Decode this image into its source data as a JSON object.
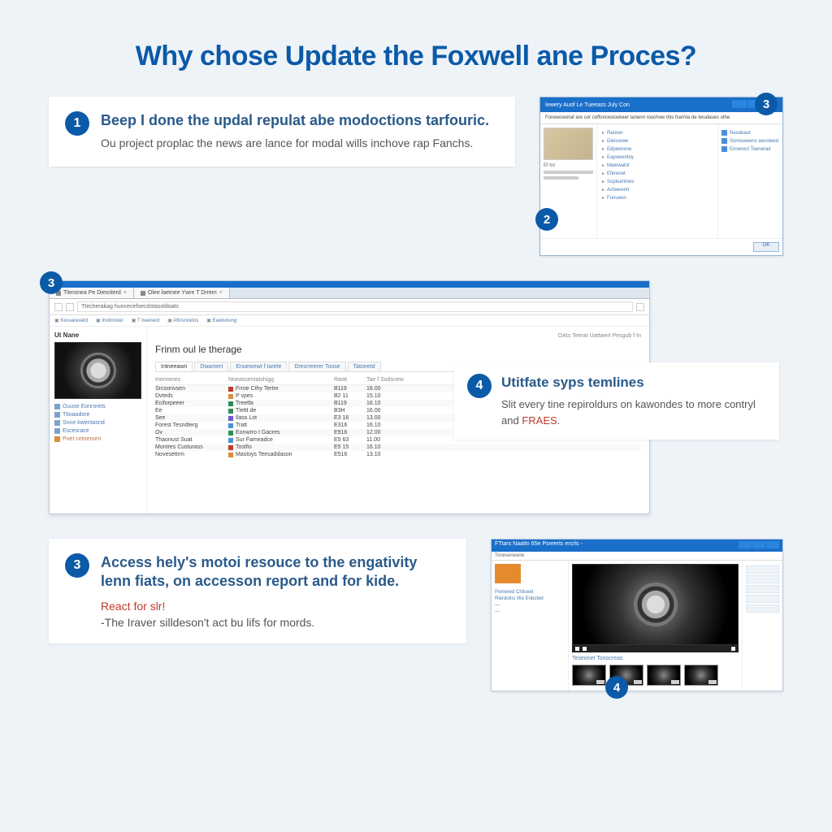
{
  "title": "Why chose Update the Foxwell ane Proces?",
  "step1": {
    "num": "1",
    "title": "Beep I done the updal repulat abe modoctions tarfouric.",
    "text": "Ou project proplac the news are lance for modal wills inchove rap Fanchs."
  },
  "step3": {
    "num": "3",
    "title": "Access hely's motoi resouce to the engativity lenn fiats, on accesson report and for kide.",
    "sub": "React for slr!",
    "note": "-The Iraver silldeson't act bu lifs for mords."
  },
  "step4": {
    "num": "4",
    "title": "Utitfate syps temlines",
    "text_pre": "Slit every tine repiroldurs on kawondes to more contryl and ",
    "text_red": "FRAES",
    "text_post": "."
  },
  "mini": {
    "title": "Iewery Auof Le Tueeass July Con",
    "desc": "Fonewcweraf are cor coffonceslookeer Ianenn roochwe this fcernta de twudaues othe",
    "ok": "OK",
    "left_label": "Ef tnt",
    "items": [
      "Ranoer",
      "Diencewe",
      "Edpewrene",
      "Eapweentoy",
      "Matewatnt",
      "Eferenet",
      "Sopluentnes",
      "Actwewntr",
      "Fonueen"
    ],
    "right": [
      "Nesdeaut",
      "Sonnueeens aensteed",
      "Enoerect Toenerad"
    ],
    "badge_top": "3",
    "badge_bot": "2"
  },
  "browser": {
    "badge": "3",
    "tabs": [
      "Tlensnea Pe Diesnlerd",
      "Olee laetnee Ywre T Drrem"
    ],
    "url": "Ttecherakag huncecefoecdstasoldoats",
    "bookmarks": [
      "Kessareuetd",
      "Inolonster",
      "T lreenerd",
      "Afinsncetos",
      "Eawlunong"
    ],
    "side_title": "Ut Nane",
    "side_links": [
      "Ouuse Eonrorets",
      "Ttioaadore",
      "Snne kwentasnd",
      "Escesrace",
      "Puet cetoenorn"
    ],
    "top_right": "OAts Teerat Uattwert    Pesgub f In",
    "main_title": "Frinm oul le therage",
    "content_tabs": [
      "Intneeawn",
      "Dwamert",
      "Enoewewt f Iarete",
      "Dresrreerer Toose",
      "Tatoeetd"
    ],
    "cols": [
      "Inenrenes",
      "Noeassentatshigg",
      "Rawt",
      "Tae f Sodsnew"
    ],
    "rows": [
      {
        "c1": "Srcoonvsen",
        "c2": "Frroe Cthy Tertre",
        "fi": "#c0392b",
        "c3": "B119",
        "c4": "18.00"
      },
      {
        "c1": "Dvteds",
        "c2": "P vpes",
        "fi": "#d98c3c",
        "c3": "B2 11",
        "c4": "15.10"
      },
      {
        "c1": "Eciforpeeer",
        "c2": "Treetfa",
        "fi": "#2e8b57",
        "c3": "B119",
        "c4": "16.10"
      },
      {
        "c1": "Ee",
        "c2": "Tlettt de",
        "fi": "#2e8b57",
        "c3": "B3H",
        "c4": "16.00"
      },
      {
        "c1": "See",
        "c2": "Ilass Lot",
        "fi": "#6a5acd",
        "c3": "E3 16",
        "c4": "13.00"
      },
      {
        "c1": "Forest Tesndterg",
        "c2": "Tratt",
        "fi": "#4a90d9",
        "c3": "E316",
        "c4": "16.10"
      },
      {
        "c1": "Ov",
        "c2": "Eonwrro t Gacres",
        "fi": "#2e8b57",
        "c3": "E916",
        "c4": "12.00"
      },
      {
        "c1": "Thaonust Suat",
        "c2": "Sur Fameadce",
        "fi": "#4a90d9",
        "c3": "E5 63",
        "c4": "11.00"
      },
      {
        "c1": "Montres Custurass",
        "c2": "Tostfis",
        "fi": "#c0392b",
        "c3": "E5 15",
        "c4": "16.10"
      },
      {
        "c1": "Novesettrm",
        "c2": "Mastoys Teesaddason",
        "fi": "#d98c3c",
        "c3": "E516",
        "c4": "13.10"
      }
    ]
  },
  "sb": {
    "title": "FTtars Naattn 65e Psreerts ercrls -",
    "addr": "Toneseneane",
    "caption": "Teseonet Tonocreas",
    "label1": "Pomered Chilseet",
    "label2": "Rierdolns We Enbobet",
    "badge": "4"
  }
}
